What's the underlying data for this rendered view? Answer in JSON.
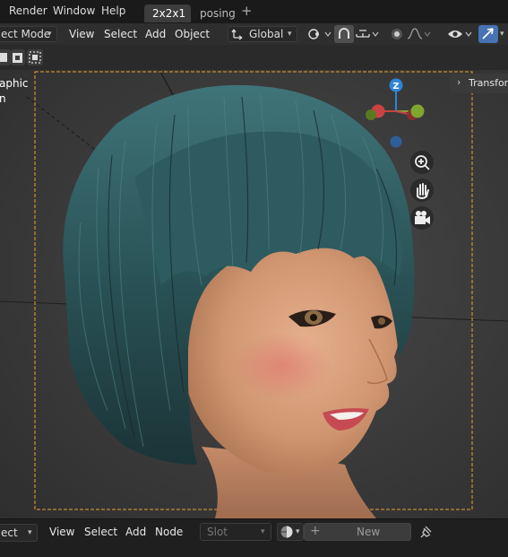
{
  "topbar": {
    "menus": [
      "Render",
      "Window",
      "Help"
    ],
    "tabs": [
      "2x2x1",
      "posing"
    ],
    "add_tab": "+"
  },
  "viewport_header": {
    "mode": "ect Mode",
    "menus": [
      "View",
      "Select",
      "Add",
      "Object"
    ],
    "orientation": "Global"
  },
  "overlay": {
    "left_text": "aphic",
    "left_text2": "n",
    "transform_label": "Transform"
  },
  "gizmo": {
    "z": "Z",
    "x": "X",
    "y": "Y"
  },
  "bottombar": {
    "mode": "ect",
    "menus": [
      "View",
      "Select",
      "Add",
      "Node"
    ],
    "slot": "Slot",
    "new_label": "New",
    "new_plus": "+"
  },
  "colors": {
    "accent_blue": "#4772b3",
    "camera_frame": "#e8a230",
    "hair": "#2f5a5e",
    "skin": "#d9a07c"
  },
  "icons": [
    "search-plus-icon",
    "hand-icon",
    "camera-icon",
    "pin-icon",
    "cursor-icon",
    "eye-icon",
    "snap-icon",
    "proportional-icon",
    "overlay-icon"
  ]
}
